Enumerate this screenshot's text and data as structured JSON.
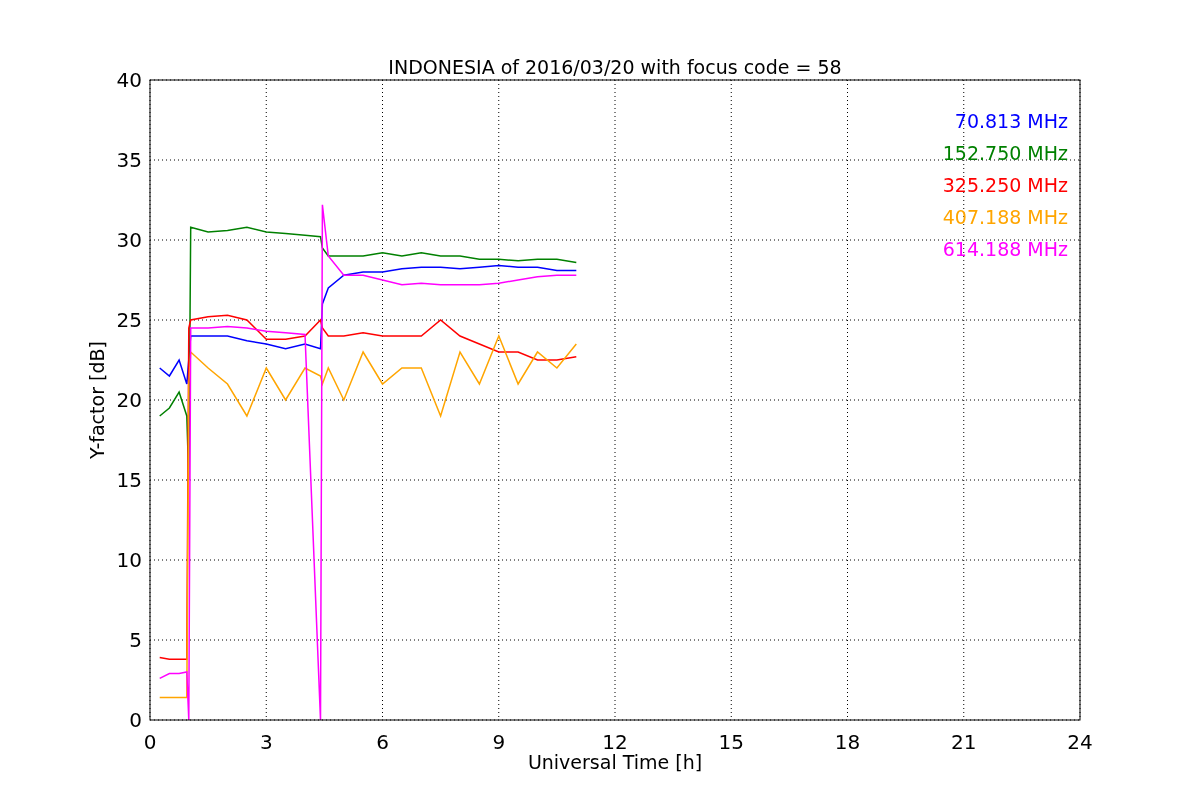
{
  "chart_data": {
    "type": "line",
    "title": "INDONESIA of 2016/03/20 with focus code = 58",
    "xlabel": "Universal Time [h]",
    "ylabel": "Y-factor [dB]",
    "x": [
      0.25,
      0.5,
      0.75,
      0.95,
      1.0,
      1.05,
      1.5,
      2,
      2.5,
      3,
      3.5,
      4,
      4.4,
      4.45,
      4.6,
      5,
      5.5,
      6,
      6.5,
      7,
      7.5,
      8,
      8.5,
      9,
      9.5,
      10,
      10.5,
      11
    ],
    "series": [
      {
        "name": "70.813 MHz",
        "color": "#0000ff",
        "values": [
          22,
          21.5,
          22.5,
          21,
          null,
          24,
          24,
          24,
          23.7,
          23.5,
          23.2,
          23.5,
          23.2,
          26,
          27,
          27.8,
          28,
          28,
          28.2,
          28.3,
          28.3,
          28.2,
          28.3,
          28.4,
          28.3,
          28.3,
          28.1,
          28.1
        ]
      },
      {
        "name": "152.750 MHz",
        "color": "#008000",
        "values": [
          19,
          19.5,
          20.5,
          19,
          15,
          30.8,
          30.5,
          30.6,
          30.8,
          30.5,
          30.4,
          30.3,
          30.2,
          29.5,
          29,
          29,
          29,
          29.2,
          29,
          29.2,
          29,
          29,
          28.8,
          28.8,
          28.7,
          28.8,
          28.8,
          28.6
        ]
      },
      {
        "name": "325.250 MHz",
        "color": "#ff0000",
        "values": [
          3.9,
          3.8,
          3.8,
          3.8,
          24.5,
          25,
          25.2,
          25.3,
          25,
          23.8,
          23.8,
          24,
          25,
          24.5,
          24,
          24,
          24.2,
          24,
          24,
          24,
          25,
          24,
          23.5,
          23,
          23,
          22.5,
          22.5,
          22.7
        ]
      },
      {
        "name": "407.188 MHz",
        "color": "#ffa500",
        "values": [
          1.4,
          1.4,
          1.4,
          1.4,
          21,
          23,
          22,
          21,
          19,
          22,
          20,
          22,
          21.5,
          21,
          22,
          20,
          23,
          21,
          22,
          22,
          19,
          23,
          21,
          24,
          21,
          23,
          22,
          23.5
        ]
      },
      {
        "name": "614.188 MHz",
        "color": "#ff00ff",
        "values": [
          2.6,
          2.9,
          2.9,
          3.0,
          0,
          24.5,
          24.5,
          24.6,
          24.5,
          24.3,
          24.2,
          24.1,
          0,
          32.2,
          29,
          27.8,
          27.8,
          27.5,
          27.2,
          27.3,
          27.2,
          27.2,
          27.2,
          27.3,
          27.5,
          27.7,
          27.8,
          27.8
        ]
      }
    ],
    "xlim": [
      0,
      24
    ],
    "ylim": [
      0,
      40
    ],
    "xticks": [
      0,
      3,
      6,
      9,
      12,
      15,
      18,
      21,
      24
    ],
    "yticks": [
      0,
      5,
      10,
      15,
      20,
      25,
      30,
      35,
      40
    ],
    "grid": true
  }
}
